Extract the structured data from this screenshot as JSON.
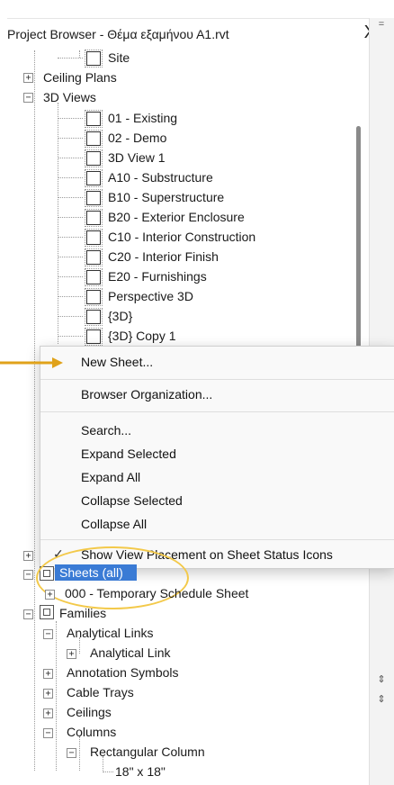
{
  "panel": {
    "title": "Project Browser - Θέμα εξαμήνου Α1.rvt",
    "close_glyph": "X",
    "gutter_marks": [
      "=",
      "⇕",
      "⇕"
    ]
  },
  "tree": {
    "site": "Site",
    "ceiling_plans": "Ceiling Plans",
    "views_3d": "3D Views",
    "views": [
      "01 - Existing",
      "02 - Demo",
      "3D View 1",
      "A10 - Substructure",
      "B10 - Superstructure",
      "B20 - Exterior Enclosure",
      "C10 - Interior Construction",
      "C20 - Interior Finish",
      "E20 - Furnishings",
      "Perspective 3D",
      "{3D}",
      "{3D} Copy 1"
    ],
    "sheets_all": "Sheets (all)",
    "sheet_item": "000 - Temporary Schedule Sheet",
    "families": "Families",
    "analytical_links": "Analytical Links",
    "analytical_link": "Analytical Link",
    "annotation_symbols": "Annotation Symbols",
    "cable_trays": "Cable Trays",
    "ceilings": "Ceilings",
    "columns": "Columns",
    "rectangular_column": "Rectangular Column",
    "size_18": "18\" x 18\""
  },
  "context_menu": {
    "new_sheet": "New Sheet...",
    "browser_organization": "Browser Organization...",
    "search": "Search...",
    "expand_selected": "Expand Selected",
    "expand_all": "Expand All",
    "collapse_selected": "Collapse Selected",
    "collapse_all": "Collapse All",
    "show_view_placement": "Show View Placement on Sheet Status Icons",
    "check_glyph": "✓"
  },
  "colors": {
    "selection": "#3a7bd5",
    "annotation_arrow": "#e0a21a",
    "annotation_ellipse": "#f3c94a"
  }
}
